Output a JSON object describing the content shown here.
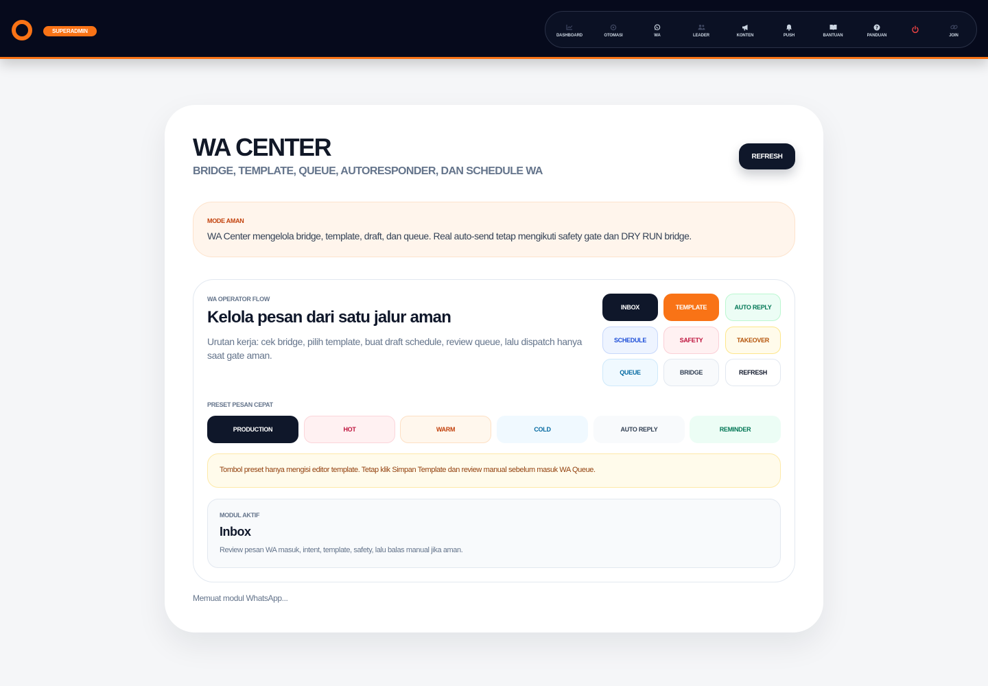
{
  "header": {
    "role_badge": "SUPERADMIN",
    "nav": [
      {
        "label": "DASHBOARD",
        "icon": "chart-line-icon"
      },
      {
        "label": "OTOMASI",
        "icon": "robot-icon"
      },
      {
        "label": "WA",
        "icon": "whatsapp-icon"
      },
      {
        "label": "LEADER",
        "icon": "users-icon"
      },
      {
        "label": "KONTEN",
        "icon": "megaphone-icon"
      },
      {
        "label": "PUSH",
        "icon": "bell-icon"
      },
      {
        "label": "BANTUAN",
        "icon": "book-icon"
      },
      {
        "label": "PANDUAN",
        "icon": "question-icon"
      },
      {
        "label": "",
        "icon": "power-icon"
      },
      {
        "label": "JOIN",
        "icon": "link-icon"
      }
    ]
  },
  "page": {
    "title": "WA CENTER",
    "subtitle": "BRIDGE, TEMPLATE, QUEUE, AUTORESPONDER, DAN SCHEDULE WA",
    "refresh_label": "REFRESH"
  },
  "safe_mode": {
    "label": "MODE AMAN",
    "text": "WA Center mengelola bridge, template, draft, dan queue. Real auto-send tetap mengikuti safety gate dan DRY RUN bridge."
  },
  "flow": {
    "label": "WA OPERATOR FLOW",
    "title": "Kelola pesan dari satu jalur aman",
    "description": "Urutan kerja: cek bridge, pilih template, buat draft schedule, review queue, lalu dispatch hanya saat gate aman.",
    "quick_buttons": [
      "INBOX",
      "TEMPLATE",
      "AUTO REPLY",
      "SCHEDULE",
      "SAFETY",
      "TAKEOVER",
      "QUEUE",
      "BRIDGE",
      "REFRESH"
    ]
  },
  "preset": {
    "label": "PRESET PESAN CEPAT",
    "buttons": [
      "PRODUCTION",
      "HOT",
      "WARM",
      "COLD",
      "AUTO REPLY",
      "REMINDER"
    ],
    "note": "Tombol preset hanya mengisi editor template. Tetap klik Simpan Template dan review manual sebelum masuk WA Queue."
  },
  "module": {
    "label": "MODUL AKTIF",
    "title": "Inbox",
    "description": "Review pesan WA masuk, intent, template, safety, lalu balas manual jika aman."
  },
  "loading_text": "Memuat modul WhatsApp...",
  "colors": {
    "accent": "#f97316",
    "nav_bg": "#060a1c",
    "dark": "#0f172a"
  }
}
